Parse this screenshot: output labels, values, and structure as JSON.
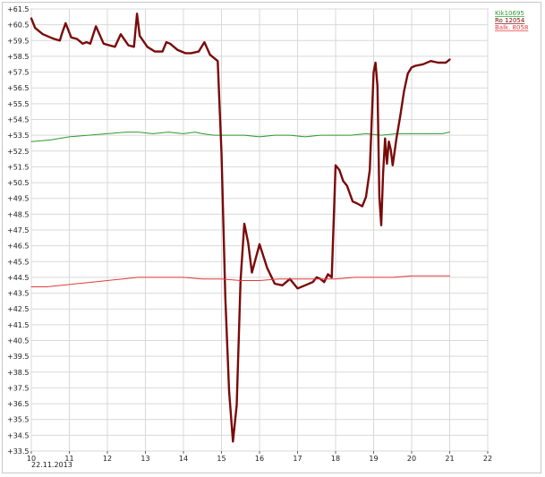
{
  "chart_data": {
    "type": "line",
    "title": "",
    "xlabel": "",
    "ylabel": "",
    "date_label": "22.11.2013",
    "xlim": [
      10,
      22
    ],
    "ylim": [
      33.5,
      61.5
    ],
    "x_ticks": [
      "10",
      "11",
      "12",
      "13",
      "14",
      "15",
      "16",
      "17",
      "18",
      "19",
      "20",
      "21",
      "22"
    ],
    "y_ticks": [
      "+61.5",
      "+60.5",
      "+59.5",
      "+58.5",
      "+57.5",
      "+56.5",
      "+55.5",
      "+54.5",
      "+53.5",
      "+52.5",
      "+51.5",
      "+50.5",
      "+49.5",
      "+48.5",
      "+47.5",
      "+46.5",
      "+45.5",
      "+44.5",
      "+43.5",
      "+42.5",
      "+41.5",
      "+40.5",
      "+39.5",
      "+38.5",
      "+37.5",
      "+36.5",
      "+35.5",
      "+34.5",
      "+33.5"
    ],
    "grid": true,
    "legend_position": "top-right",
    "series": [
      {
        "name": "Kik10695",
        "color": "#2e9a2e",
        "width": 1,
        "x": [
          10,
          10.5,
          11,
          11.5,
          12,
          12.5,
          12.8,
          13.2,
          13.6,
          14,
          14.3,
          14.5,
          14.8,
          15.2,
          15.6,
          16,
          16.4,
          16.8,
          17.2,
          17.6,
          18,
          18.4,
          18.8,
          19.2,
          19.6,
          20,
          20.4,
          20.8,
          21
        ],
        "y": [
          53.1,
          53.2,
          53.4,
          53.5,
          53.6,
          53.7,
          53.7,
          53.6,
          53.7,
          53.6,
          53.7,
          53.6,
          53.5,
          53.5,
          53.5,
          53.4,
          53.5,
          53.5,
          53.4,
          53.5,
          53.5,
          53.5,
          53.6,
          53.5,
          53.6,
          53.6,
          53.6,
          53.6,
          53.7
        ]
      },
      {
        "name": "Ro 12054",
        "color": "#7a0a0a",
        "width": 2.4,
        "x": [
          10,
          10.1,
          10.3,
          10.5,
          10.6,
          10.75,
          10.8,
          10.9,
          11.05,
          11.2,
          11.35,
          11.45,
          11.55,
          11.7,
          11.9,
          12.05,
          12.2,
          12.35,
          12.55,
          12.7,
          12.78,
          12.85,
          13.05,
          13.25,
          13.45,
          13.55,
          13.65,
          13.85,
          14.05,
          14.2,
          14.4,
          14.55,
          14.7,
          14.9,
          15,
          15.1,
          15.2,
          15.3,
          15.4,
          15.5,
          15.6,
          15.7,
          15.8,
          16,
          16.2,
          16.4,
          16.6,
          16.8,
          16.9,
          17,
          17.2,
          17.4,
          17.5,
          17.6,
          17.7,
          17.8,
          17.9,
          18,
          18.1,
          18.2,
          18.3,
          18.45,
          18.55,
          18.7,
          18.8,
          18.9,
          19,
          19.05,
          19.1,
          19.15,
          19.2,
          19.25,
          19.3,
          19.35,
          19.4,
          19.45,
          19.5,
          19.6,
          19.7,
          19.8,
          19.9,
          20,
          20.1,
          20.3,
          20.5,
          20.7,
          20.9,
          21
        ],
        "y": [
          60.9,
          60.3,
          59.9,
          59.7,
          59.6,
          59.5,
          59.9,
          60.6,
          59.7,
          59.6,
          59.3,
          59.4,
          59.3,
          60.4,
          59.3,
          59.2,
          59.1,
          59.9,
          59.2,
          59.1,
          61.2,
          59.8,
          59.1,
          58.8,
          58.8,
          59.4,
          59.3,
          58.9,
          58.7,
          58.7,
          58.8,
          59.4,
          58.6,
          58.2,
          52.4,
          43.2,
          37.3,
          34.1,
          36.4,
          44.3,
          47.9,
          46.7,
          44.8,
          46.6,
          45.1,
          44.1,
          44.0,
          44.4,
          44.1,
          43.8,
          44.0,
          44.2,
          44.5,
          44.4,
          44.2,
          44.7,
          44.5,
          51.6,
          51.3,
          50.6,
          50.3,
          49.3,
          49.2,
          49.0,
          49.6,
          51.3,
          57.5,
          58.1,
          56.6,
          49.6,
          47.8,
          51.1,
          53.3,
          51.7,
          53.1,
          52.6,
          51.6,
          53.3,
          54.7,
          56.3,
          57.4,
          57.8,
          57.9,
          58.0,
          58.2,
          58.1,
          58.1,
          58.3
        ]
      },
      {
        "name": "Balk. 8058",
        "color": "#e23a3a",
        "width": 1,
        "x": [
          10,
          10.4,
          10.8,
          11.2,
          11.6,
          12,
          12.4,
          12.8,
          13.2,
          13.6,
          14,
          14.5,
          15,
          15.5,
          16,
          16.5,
          17,
          17.5,
          18,
          18.5,
          19,
          19.5,
          20,
          20.5,
          21
        ],
        "y": [
          43.9,
          43.9,
          44.0,
          44.1,
          44.2,
          44.3,
          44.4,
          44.5,
          44.5,
          44.5,
          44.5,
          44.4,
          44.4,
          44.3,
          44.3,
          44.4,
          44.4,
          44.4,
          44.4,
          44.5,
          44.5,
          44.5,
          44.6,
          44.6,
          44.6
        ]
      }
    ]
  }
}
